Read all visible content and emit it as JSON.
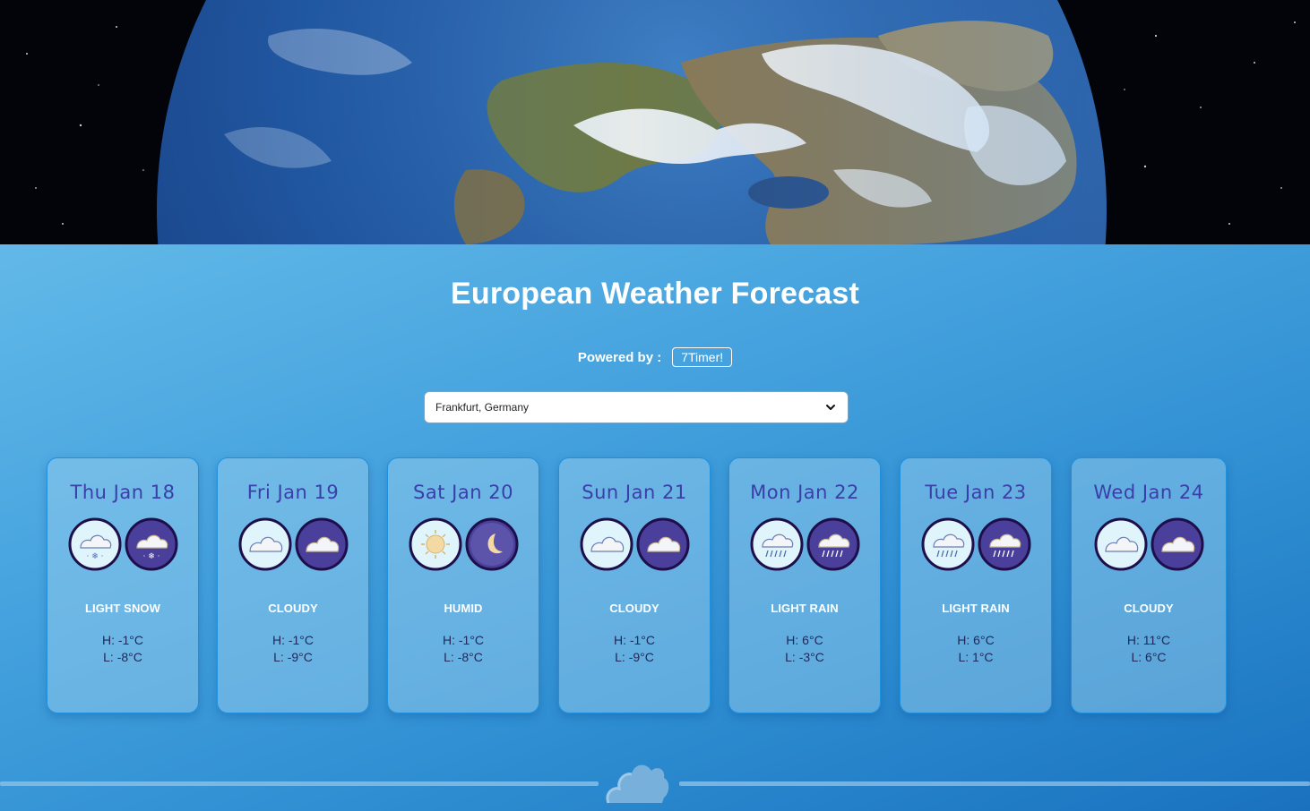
{
  "header": {
    "title": "European Weather Forecast",
    "powered_label": "Powered by :",
    "powered_link": "7Timer!"
  },
  "location_select": {
    "selected": "Frankfurt, Germany",
    "icon": "chevron-down-icon"
  },
  "colors": {
    "panel_top": "#62b9e8",
    "panel_bottom": "#1a72bf",
    "date_text": "#3a3ea8",
    "card_border": "#1e90e0"
  },
  "forecast": [
    {
      "date": "Thu Jan 18",
      "condition": "LIGHT SNOW",
      "high": "H: -1°C",
      "low": "L: -8°C",
      "day_icon": "light-snow-day-icon",
      "night_icon": "light-snow-night-icon"
    },
    {
      "date": "Fri Jan 19",
      "condition": "CLOUDY",
      "high": "H: -1°C",
      "low": "L: -9°C",
      "day_icon": "cloudy-day-icon",
      "night_icon": "cloudy-night-icon"
    },
    {
      "date": "Sat Jan 20",
      "condition": "HUMID",
      "high": "H: -1°C",
      "low": "L: -8°C",
      "day_icon": "humid-day-icon",
      "night_icon": "humid-night-icon"
    },
    {
      "date": "Sun Jan 21",
      "condition": "CLOUDY",
      "high": "H: -1°C",
      "low": "L: -9°C",
      "day_icon": "cloudy-day-icon",
      "night_icon": "cloudy-night-icon"
    },
    {
      "date": "Mon Jan 22",
      "condition": "LIGHT RAIN",
      "high": "H: 6°C",
      "low": "L: -3°C",
      "day_icon": "light-rain-day-icon",
      "night_icon": "light-rain-night-icon"
    },
    {
      "date": "Tue Jan 23",
      "condition": "LIGHT RAIN",
      "high": "H: 6°C",
      "low": "L: 1°C",
      "day_icon": "light-rain-day-icon",
      "night_icon": "light-rain-night-icon"
    },
    {
      "date": "Wed Jan 24",
      "condition": "CLOUDY",
      "high": "H: 11°C",
      "low": "L: 6°C",
      "day_icon": "cloudy-day-icon",
      "night_icon": "cloudy-night-icon"
    }
  ]
}
